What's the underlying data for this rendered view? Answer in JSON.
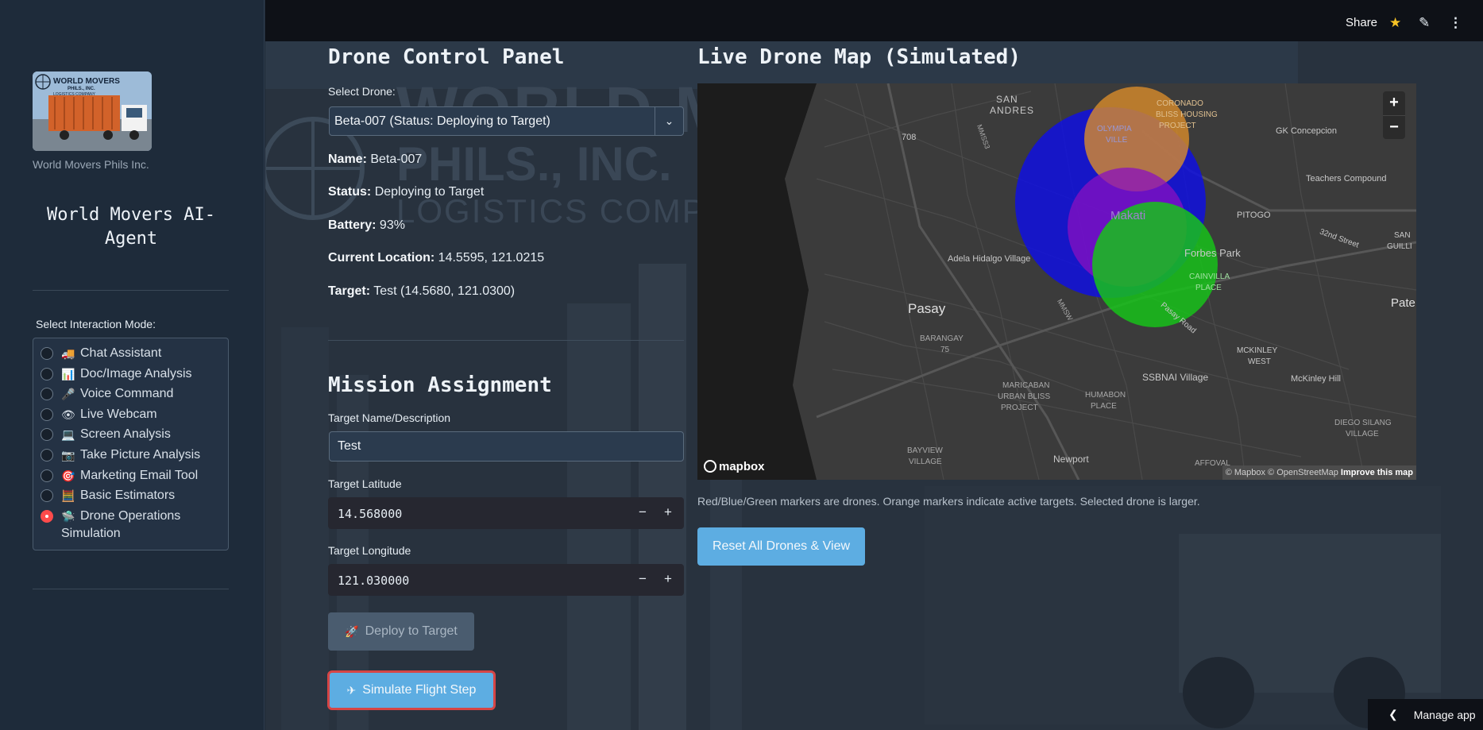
{
  "sidebar": {
    "logo_text_1": "WORLD MOVERS",
    "logo_text_2": "PHILS., INC.",
    "logo_text_3": "LOGISTICS COMPANY",
    "company_caption": "World Movers Phils Inc.",
    "app_title_line1": "World Movers AI-",
    "app_title_line2": "Agent",
    "mode_label": "Select Interaction Mode:",
    "modes": [
      {
        "label": "Chat Assistant",
        "icon": "truck-emoji",
        "glyph": "🚚",
        "selected": false
      },
      {
        "label": "Doc/Image Analysis",
        "icon": "chart-emoji",
        "glyph": "📊",
        "selected": false
      },
      {
        "label": "Voice Command",
        "icon": "microphone-emoji",
        "glyph": "🎤",
        "selected": false
      },
      {
        "label": "Live Webcam",
        "icon": "eye-emoji",
        "glyph": "👁",
        "selected": false
      },
      {
        "label": "Screen Analysis",
        "icon": "laptop-emoji",
        "glyph": "💻",
        "selected": false
      },
      {
        "label": "Take Picture Analysis",
        "icon": "camera-emoji",
        "glyph": "📷",
        "selected": false
      },
      {
        "label": "Marketing Email Tool",
        "icon": "target-emoji",
        "glyph": "🎯",
        "selected": false
      },
      {
        "label": "Basic Estimators",
        "icon": "abacus-emoji",
        "glyph": "🧮",
        "selected": false
      },
      {
        "label": "Drone Operations",
        "label2": "Simulation",
        "icon": "drone-emoji",
        "glyph": "🛸",
        "selected": true
      }
    ]
  },
  "header": {
    "share_label": "Share",
    "star_icon": "★",
    "edit_icon": "✎",
    "more_icon": "⋮"
  },
  "background_watermark": {
    "line1": "WORLD M",
    "line2": "PHILS., INC.",
    "line3": "LOGISTICS COMPA"
  },
  "control_panel": {
    "title": "Drone Control Panel",
    "select_label": "Select Drone:",
    "selected_drone": "Beta-007 (Status: Deploying to Target)",
    "name_label": "Name:",
    "name_value": "Beta-007",
    "status_label": "Status:",
    "status_value": "Deploying to Target",
    "battery_label": "Battery:",
    "battery_value": "93%",
    "location_label": "Current Location:",
    "location_value": "14.5595, 121.0215",
    "target_label": "Target:",
    "target_value": "Test (14.5680, 121.0300)"
  },
  "mission": {
    "title": "Mission Assignment",
    "target_name_label": "Target Name/Description",
    "target_name_value": "Test",
    "lat_label": "Target Latitude",
    "lat_value": "14.568000",
    "lon_label": "Target Longitude",
    "lon_value": "121.030000",
    "minus": "−",
    "plus": "+",
    "deploy_label": "Deploy to Target",
    "deploy_glyph": "🚀",
    "simulate_label": "Simulate Flight Step",
    "simulate_glyph": "✈"
  },
  "map": {
    "title": "Live Drone Map (Simulated)",
    "zoom_in": "+",
    "zoom_out": "−",
    "brand": "mapbox",
    "attribution": "© Mapbox © OpenStreetMap",
    "improve": "Improve this map",
    "labels": [
      "SAN",
      "ANDRES",
      "708",
      "OLYMPIA",
      "VILLE",
      "CORONADO",
      "BLISS HOUSING",
      "PROJECT",
      "GK Concepcion",
      "Teachers Compound",
      "Makati",
      "PITOGO",
      "32nd Street",
      "Forbes Park",
      "SAN",
      "GUILLI",
      "Adela Hidalgo Village",
      "Pasay",
      "BARANGAY",
      "75",
      "CAINVILLA",
      "PLACE",
      "Pasay Road",
      "MCKINLEY",
      "WEST",
      "McKinley Hill",
      "Pate",
      "SSBNAI Village",
      "MARICABAN",
      "URBAN BLISS",
      "PROJECT",
      "HUMABON",
      "PLACE",
      "DIEGO SILANG",
      "VILLAGE",
      "BAYVIEW",
      "VILLAGE",
      "Newport",
      "AFFOVAL",
      "MMSS3",
      "MMSW"
    ],
    "markers": [
      {
        "name": "blue-drone",
        "color": "#1010e0"
      },
      {
        "name": "orange-target",
        "color": "#d98c2b"
      },
      {
        "name": "red-drone",
        "color": "#8a10c0"
      },
      {
        "name": "green-drone",
        "color": "#18c21a"
      }
    ],
    "caption": "Red/Blue/Green markers are drones. Orange markers indicate active targets. Selected drone is larger.",
    "reset_label": "Reset All Drones & View"
  },
  "footer": {
    "manage_label": "Manage app"
  }
}
